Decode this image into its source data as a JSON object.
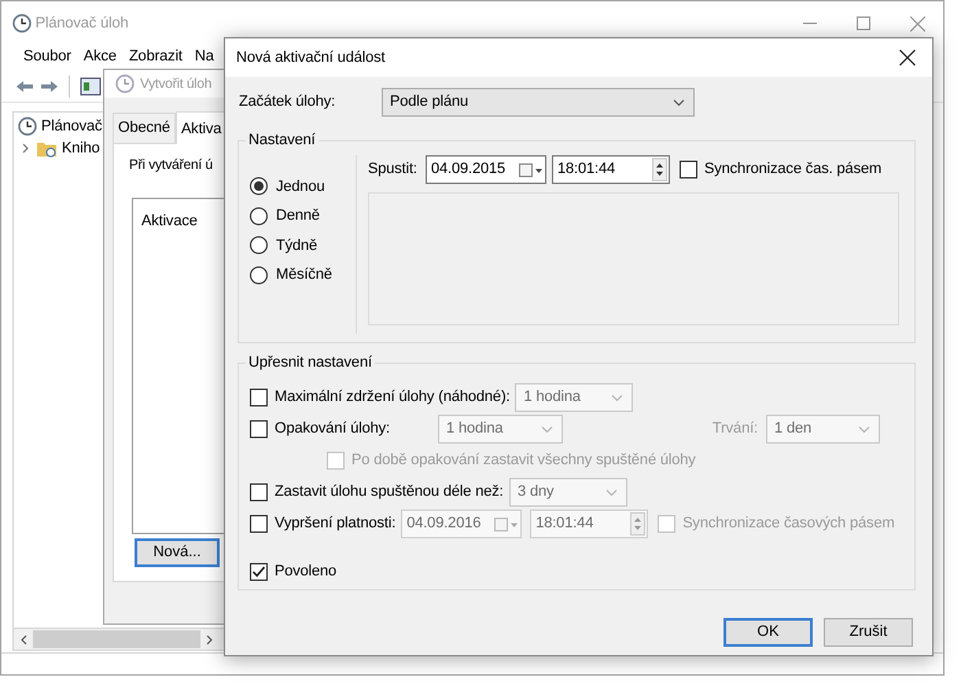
{
  "main_window": {
    "title": "Plánovač úloh",
    "menu": [
      "Soubor",
      "Akce",
      "Zobrazit",
      "Na"
    ],
    "tree": [
      {
        "label": "Plánovač",
        "children": [
          {
            "label": "Kniho",
            "expanded": false
          }
        ]
      }
    ]
  },
  "create_task": {
    "title": "Vytvořit úloh",
    "tabs": [
      {
        "label": "Obecné",
        "selected": false
      },
      {
        "label": "Aktiva",
        "selected": true
      }
    ],
    "description": "Při vytváření ú",
    "list_header": "Aktivace",
    "new_button": "Nová..."
  },
  "dialog": {
    "title": "Nová aktivační událost",
    "start_label": "Začátek úlohy:",
    "start_value": "Podle plánu",
    "settings": {
      "title": "Nastavení",
      "frequency": [
        {
          "label": "Jednou",
          "selected": true
        },
        {
          "label": "Denně",
          "selected": false
        },
        {
          "label": "Týdně",
          "selected": false
        },
        {
          "label": "Měsíčně",
          "selected": false
        }
      ],
      "start_label": "Spustit:",
      "date": "04.09.2015",
      "time": "18:01:44",
      "sync": {
        "label": "Synchronizace čas. pásem",
        "checked": false
      }
    },
    "advanced": {
      "title": "Upřesnit nastavení",
      "rows": [
        {
          "kind": "combo",
          "label": "Maximální zdržení úlohy (náhodné):",
          "checked": false,
          "combo": {
            "value": "1 hodina",
            "disabled": true
          }
        },
        {
          "kind": "repeat",
          "label": "Opakování úlohy:",
          "checked": false,
          "combo": {
            "value": "1 hodina",
            "disabled": true
          },
          "duration_label": "Trvání:",
          "duration": {
            "value": "1 den",
            "disabled": true
          }
        },
        {
          "kind": "sub",
          "label": "Po době opakování zastavit všechny spuštěné úlohy",
          "checked": false,
          "disabled": true
        },
        {
          "kind": "combo",
          "label": "Zastavit úlohu spuštěnou déle než:",
          "checked": false,
          "combo": {
            "value": "3 dny",
            "disabled": true
          }
        },
        {
          "kind": "expiry",
          "label": "Vypršení platnosti:",
          "checked": false,
          "date": "04.09.2016",
          "time": "18:01:44",
          "disabled": true,
          "sync": {
            "label": "Synchronizace časových pásem",
            "checked": false,
            "disabled": true
          }
        },
        {
          "kind": "plain",
          "label": "Povoleno",
          "checked": true
        }
      ]
    },
    "buttons": [
      {
        "label": "OK",
        "default": true
      },
      {
        "label": "Zrušit",
        "default": false
      }
    ]
  }
}
